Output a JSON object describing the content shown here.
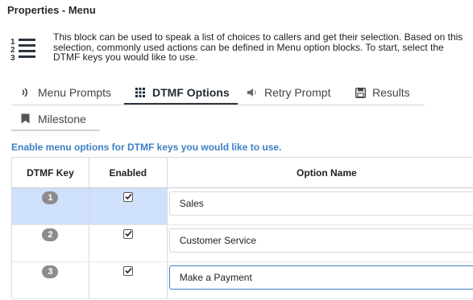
{
  "window": {
    "title": "Properties - Menu"
  },
  "description": "This block can be used to speak a list of choices to callers and get their selection. Based on this selection, commonly used actions can be defined in Menu option blocks. To start, select the DTMF keys you would like to use.",
  "tabs": [
    {
      "label": "Menu Prompts",
      "icon": "audio-wave-icon"
    },
    {
      "label": "DTMF Options",
      "icon": "keypad-icon",
      "active": true
    },
    {
      "label": "Retry Prompt",
      "icon": "speaker-icon"
    },
    {
      "label": "Results",
      "icon": "save-disk-icon"
    }
  ],
  "tab_row2": {
    "label": "Milestone",
    "icon": "bookmark-icon"
  },
  "hint": "Enable menu options for DTMF keys you would like to use.",
  "table": {
    "headers": [
      "DTMF Key",
      "Enabled",
      "Option Name"
    ],
    "rows": [
      {
        "key": "1",
        "enabled": true,
        "option": "Sales"
      },
      {
        "key": "2",
        "enabled": true,
        "option": "Customer Service"
      },
      {
        "key": "3",
        "enabled": true,
        "option": "Make a Payment"
      }
    ]
  },
  "colors": {
    "accent": "#3d7fc4",
    "selected_row": "#cfe0fb",
    "badge": "#8c8c8c"
  }
}
